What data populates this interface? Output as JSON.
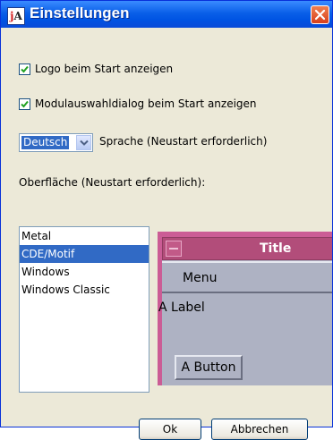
{
  "window": {
    "title": "Einstellungen",
    "icon_letters": {
      "first": "j",
      "second": "A"
    },
    "titlebar_color": "#0054e3"
  },
  "options": {
    "show_logo": {
      "label": "Logo beim Start anzeigen",
      "checked": true
    },
    "show_module_dialog": {
      "label": "Modulauswahldialog beim Start anzeigen",
      "checked": true
    }
  },
  "language": {
    "selected": "Deutsch",
    "label": "Sprache (Neustart erforderlich)"
  },
  "surface": {
    "label": "Oberfläche (Neustart erforderlich):",
    "items": [
      {
        "label": "Metal",
        "selected": false
      },
      {
        "label": "CDE/Motif",
        "selected": true
      },
      {
        "label": "Windows",
        "selected": false
      },
      {
        "label": "Windows Classic",
        "selected": false
      }
    ]
  },
  "preview": {
    "title": "Title",
    "menu": "Menu",
    "label": "A Label",
    "button": "A Button",
    "accent_color": "#cb5c95",
    "body_color": "#aeb2c3"
  },
  "buttons": {
    "ok": "Ok",
    "cancel": "Abbrechen"
  }
}
